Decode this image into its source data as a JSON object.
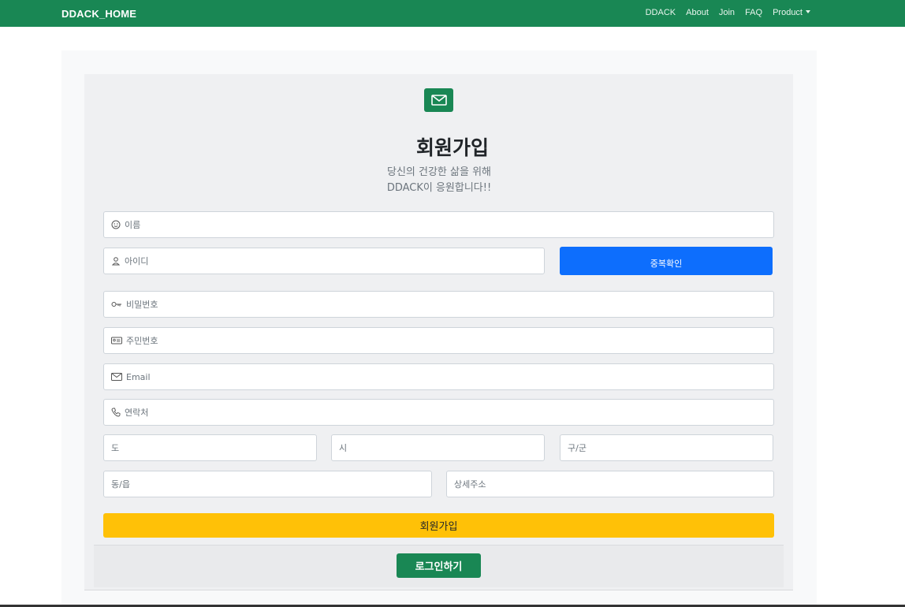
{
  "navbar": {
    "brand": "DDACK_HOME",
    "links": [
      {
        "label": "DDACK"
      },
      {
        "label": "About"
      },
      {
        "label": "Join"
      },
      {
        "label": "FAQ"
      },
      {
        "label": "Product"
      }
    ],
    "bg_color": "#198754"
  },
  "header": {
    "icon": "envelope-icon",
    "title": "회원가입",
    "subtitle_line1": "당신의 건강한 삶을 위해",
    "subtitle_line2": "DDACK이 응원합니다!!"
  },
  "form": {
    "name_placeholder": "이름",
    "id_placeholder": "아이디",
    "dup_check_label": "중복확인",
    "password_placeholder": "비밀번호",
    "rrn_placeholder": "주민번호",
    "email_placeholder": "Email",
    "phone_placeholder": "연락처",
    "province_placeholder": "도",
    "city_placeholder": "시",
    "district_placeholder": "구/군",
    "town_placeholder": "동/읍",
    "detail_address_placeholder": "상세주소",
    "submit_label": "회원가입"
  },
  "footer": {
    "login_label": "로그인하기"
  },
  "colors": {
    "primary_green": "#198754",
    "dup_button_blue": "#0d6efd",
    "submit_yellow": "#ffc107"
  }
}
